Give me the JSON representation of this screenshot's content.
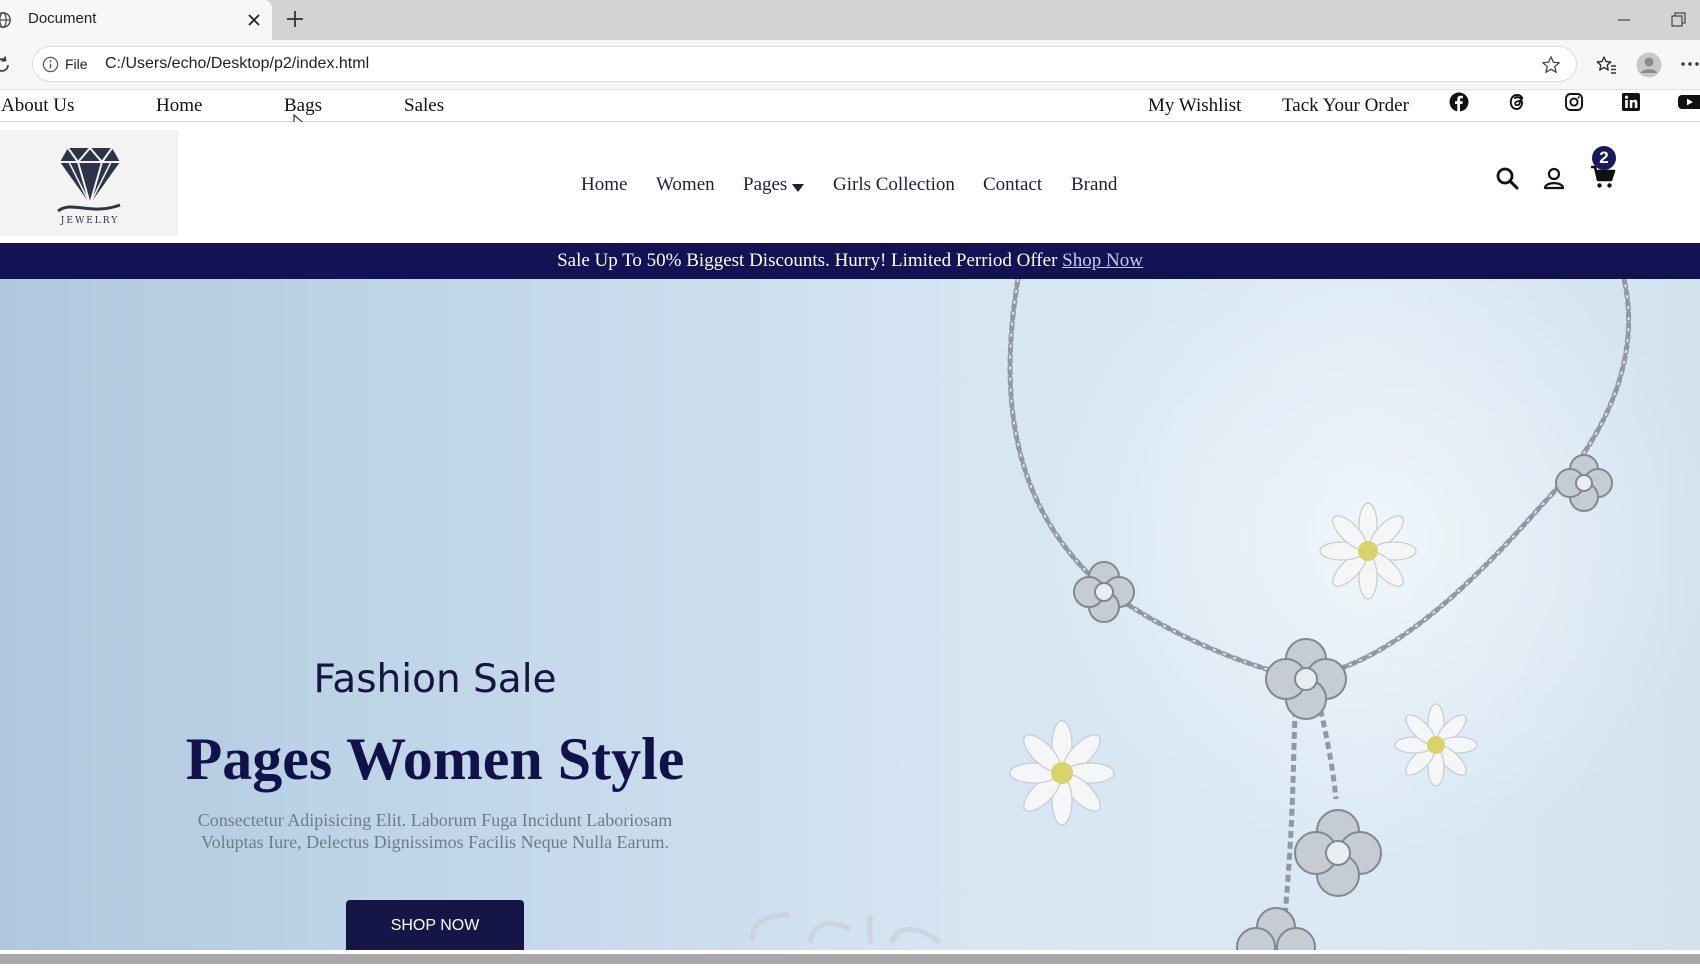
{
  "browser": {
    "tab_title": "Document",
    "address_prefix": "File",
    "url": "C:/Users/echo/Desktop/p2/index.html"
  },
  "topbar": {
    "left_links": [
      "About Us",
      "Home",
      "Bags",
      "Sales"
    ],
    "right_links": [
      "My Wishlist",
      "Tack Your Order"
    ],
    "social_icons": [
      "facebook-icon",
      "threads-icon",
      "instagram-icon",
      "linkedin-icon",
      "youtube-icon"
    ]
  },
  "header": {
    "logo_text": "JEWELRY",
    "nav": [
      "Home",
      "Women",
      "Pages",
      "Girls Collection",
      "Contact",
      "Brand"
    ],
    "cart_count": "2"
  },
  "promo": {
    "text": "Sale Up To 50% Biggest Discounts. Hurry! Limited Perriod Offer ",
    "link": "Shop Now"
  },
  "hero": {
    "kicker": "Fashion Sale",
    "title": "Pages Women Style",
    "description": "Consectetur Adipisicing Elit. Laborum Fuga Incidunt Laboriosam Voluptas Iure, Delectus Dignissimos Facilis Neque Nulla Earum.",
    "button": "SHOP NOW"
  },
  "colors": {
    "brand_navy": "#121255",
    "hero_bg": "#c7dbec"
  }
}
